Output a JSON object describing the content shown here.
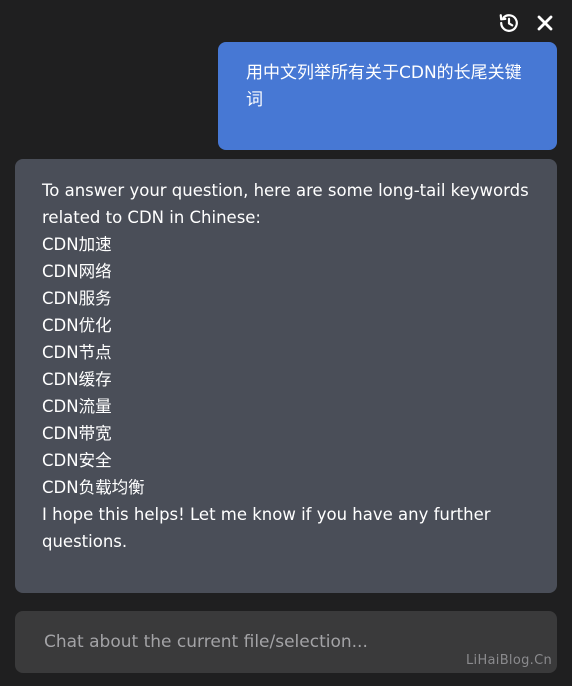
{
  "header": {
    "icons": [
      "history-icon",
      "close-icon"
    ]
  },
  "conversation": {
    "user_message": "用中文列举所有关于CDN的长尾关键词",
    "assistant_lines": [
      "To answer your question, here are some long-tail keywords",
      "related to CDN in Chinese:",
      "CDN加速",
      "CDN网络",
      "CDN服务",
      "CDN优化",
      "CDN节点",
      "CDN缓存",
      "CDN流量",
      "CDN带宽",
      "CDN安全",
      "CDN负载均衡",
      "I hope this helps! Let me know if you have any further",
      "questions."
    ]
  },
  "input": {
    "placeholder": "Chat about the current file/selection...",
    "value": ""
  },
  "watermark": "LiHaiBlog.Cn",
  "colors": {
    "background": "#1f1f20",
    "user_bubble": "#4778d4",
    "assistant_bubble": "#4a4e58",
    "input_background": "#3a3a3b"
  }
}
